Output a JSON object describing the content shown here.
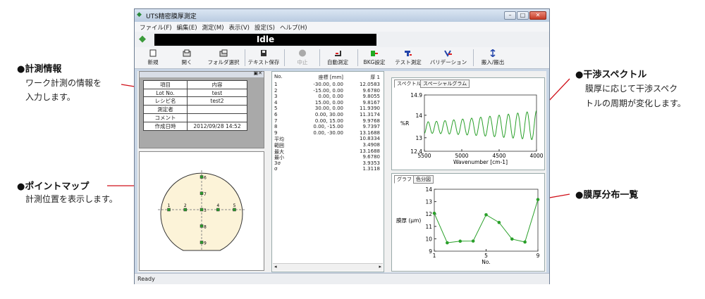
{
  "annotations": {
    "measurement_info": {
      "title": "●計測情報",
      "body": [
        "ワーク計測の情報を",
        "入力します。"
      ]
    },
    "point_map": {
      "title": "●ポイントマップ",
      "body": [
        "計測位置を表示します。"
      ]
    },
    "interference_spectrum": {
      "title": "●干渉スペクトル",
      "body": [
        "膜厚に応じて干渉スペク",
        "トルの周期が変化します。"
      ]
    },
    "thickness_list": {
      "title": "●膜厚分布一覧"
    }
  },
  "window": {
    "title": "UTS精密膜厚測定",
    "status": "Idle",
    "statusbar": "Ready"
  },
  "menu": [
    "ファイル(F)",
    "編集(E)",
    "測定(M)",
    "表示(V)",
    "設定(S)",
    "ヘルプ(H)"
  ],
  "toolbar": [
    "新規",
    "開く",
    "フォルダ選択",
    "テキスト保存",
    "中止",
    "自動測定",
    "BKG設定",
    "テスト測定",
    "バリデーション",
    "搬入/搬出"
  ],
  "info_table": {
    "header": [
      "項目",
      "内容"
    ],
    "rows": [
      {
        "k": "Lot No.",
        "v": "test"
      },
      {
        "k": "レシピ名",
        "v": "test2"
      },
      {
        "k": "測定者",
        "v": ""
      },
      {
        "k": "コメント",
        "v": ""
      },
      {
        "k": "作成日時",
        "v": "2012/09/28 14:52"
      }
    ]
  },
  "point_map": {
    "labels": [
      "1",
      "2",
      "3",
      "4",
      "5",
      "6",
      "7",
      "8",
      "9"
    ]
  },
  "list": {
    "header": [
      "No.",
      "座標 [mm]",
      "厚 1"
    ],
    "rows": [
      [
        "1",
        "-30.00, 0.00",
        "12.0583"
      ],
      [
        "2",
        "-15.00, 0.00",
        "9.6780"
      ],
      [
        "3",
        "0.00, 0.00",
        "9.8055"
      ],
      [
        "4",
        "15.00, 0.00",
        "9.8167"
      ],
      [
        "5",
        "30.00, 0.00",
        "11.9390"
      ],
      [
        "6",
        "0.00, 30.00",
        "11.3174"
      ],
      [
        "7",
        "0.00, 15.00",
        "9.9768"
      ],
      [
        "8",
        "0.00, -15.00",
        "9.7397"
      ],
      [
        "9",
        "0.00, -30.00",
        "13.1688"
      ],
      [
        "平均",
        "",
        "10.8334"
      ],
      [
        "範囲",
        "",
        "3.4908"
      ],
      [
        "最大",
        "",
        "13.1688"
      ],
      [
        "最小",
        "",
        "9.6780"
      ],
      [
        "3σ",
        "",
        "3.9353"
      ],
      [
        "σ",
        "",
        "1.3118"
      ]
    ]
  },
  "spectrum_tabs": [
    "スペクトル",
    "スペーシャルグラム"
  ],
  "dist_tabs": [
    "グラフ",
    "色分図"
  ],
  "chart_data": [
    {
      "type": "line",
      "xlabel": "Wavenumber [cm-1]",
      "ylabel": "%R",
      "xlim": [
        5500,
        4000
      ],
      "ylim": [
        12.4,
        14.9
      ],
      "xticks": [
        "5500",
        "5000",
        "4500",
        "4000"
      ],
      "yticks": [
        "12.4",
        "13",
        "14",
        "14.9"
      ],
      "series": [
        {
          "color": "#2aa02a",
          "x": [
            5500,
            4000
          ],
          "oscillation": {
            "cycles": 12.5,
            "center_start": 13.45,
            "center_end": 13.55,
            "amp_start": 0.25,
            "amp_end": 0.65
          }
        }
      ]
    },
    {
      "type": "line",
      "xlabel": "No.",
      "ylabel": "膜厚 (μm)",
      "xlim": [
        1,
        9
      ],
      "ylim": [
        9,
        14
      ],
      "xticks": [
        "1",
        "5",
        "9"
      ],
      "yticks": [
        "9",
        "10",
        "11",
        "12",
        "13",
        "14"
      ],
      "x": [
        1,
        2,
        3,
        4,
        5,
        6,
        7,
        8,
        9
      ],
      "series": [
        {
          "color": "#2aa02a",
          "values": [
            12.0583,
            9.678,
            9.8055,
            9.8167,
            11.939,
            11.3174,
            9.9768,
            9.7397,
            13.1688
          ]
        }
      ]
    }
  ]
}
